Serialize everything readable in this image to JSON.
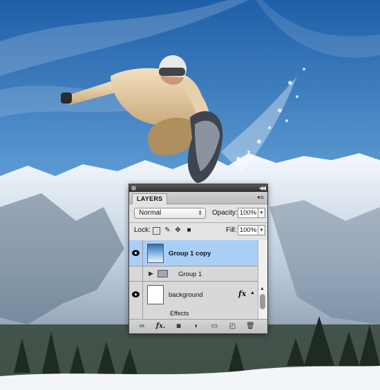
{
  "panel": {
    "tab_label": "LAYERS",
    "blend_mode": "Normal",
    "opacity_label": "Opacity:",
    "opacity_value": "100%",
    "lock_label": "Lock:",
    "fill_label": "Fill:",
    "fill_value": "100%",
    "layers": [
      {
        "name": "Group 1 copy",
        "visible": true,
        "selected": true,
        "type": "smart-object"
      },
      {
        "name": "Group 1",
        "visible": false,
        "selected": false,
        "type": "group"
      },
      {
        "name": "background",
        "visible": true,
        "selected": false,
        "type": "layer",
        "has_effects": true,
        "fx_label": "fx"
      },
      {
        "name": "Effects",
        "type": "effects-sublayer"
      }
    ],
    "bottom_icons": [
      "link-icon",
      "fx-icon",
      "mask-icon",
      "adjustment-icon",
      "folder-icon",
      "new-layer-icon",
      "trash-icon"
    ],
    "bottom_fx_label": "fx."
  },
  "colors": {
    "selected_row": "#a9cff7",
    "panel_bg": "#e3e3e3"
  }
}
